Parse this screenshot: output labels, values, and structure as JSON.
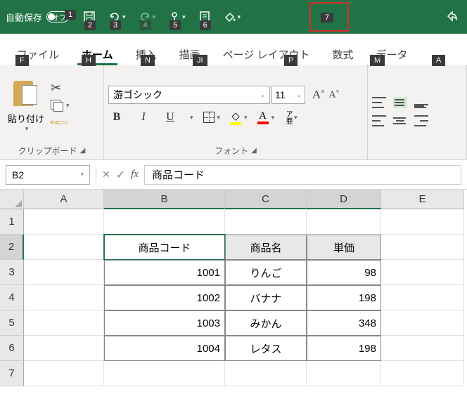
{
  "titlebar": {
    "autosave_label": "自動保存",
    "autosave_state": "オフ",
    "badges": [
      "1",
      "2",
      "3",
      "4",
      "5",
      "6",
      "7"
    ]
  },
  "tabs": {
    "file": "ファイル",
    "file_key": "F",
    "home": "ホーム",
    "home_key": "H",
    "insert": "挿入",
    "insert_key": "N",
    "draw": "描画",
    "draw_key": "JI",
    "layout": "ページ レイアウト",
    "layout_key": "P",
    "formula": "数式",
    "formula_key": "M",
    "data": "データ",
    "data_key": "A"
  },
  "ribbon": {
    "clipboard": {
      "paste": "貼り付け",
      "label": "クリップボード"
    },
    "font": {
      "name": "游ゴシック",
      "size": "11",
      "ruby": "ア亜",
      "label": "フォント"
    }
  },
  "formula_bar": {
    "namebox": "B2",
    "content": "商品コード"
  },
  "grid": {
    "cols": [
      "A",
      "B",
      "C",
      "D",
      "E"
    ],
    "rows": [
      "1",
      "2",
      "3",
      "4",
      "5",
      "6",
      "7"
    ],
    "header": {
      "b": "商品コード",
      "c": "商品名",
      "d": "単価"
    },
    "data": [
      {
        "code": "1001",
        "name": "りんご",
        "price": "98"
      },
      {
        "code": "1002",
        "name": "バナナ",
        "price": "198"
      },
      {
        "code": "1003",
        "name": "みかん",
        "price": "348"
      },
      {
        "code": "1004",
        "name": "レタス",
        "price": "198"
      }
    ]
  }
}
